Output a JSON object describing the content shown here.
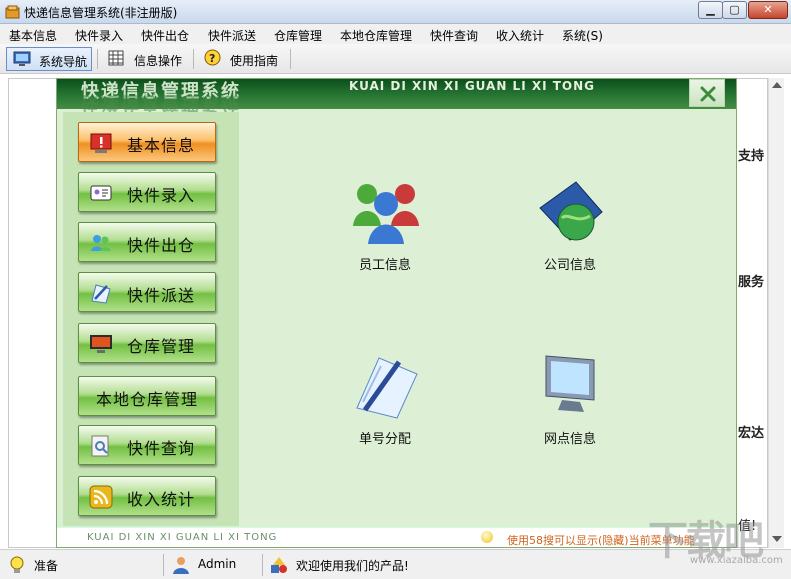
{
  "window": {
    "title": "快递信息管理系统(非注册版)",
    "min": "▁",
    "max": "▢",
    "close": "✕"
  },
  "menu": [
    "基本信息",
    "快件录入",
    "快件出仓",
    "快件派送",
    "仓库管理",
    "本地仓库管理",
    "快件查询",
    "收入统计",
    "系统(S)"
  ],
  "toolbar": {
    "items": [
      {
        "label": "系统导航",
        "icon": "monitor-icon",
        "active": true
      },
      {
        "label": "信息操作",
        "icon": "grid-icon",
        "active": false
      },
      {
        "label": "使用指南",
        "icon": "help-icon",
        "active": false
      }
    ]
  },
  "background_text": [
    "支持",
    "服务",
    "宏达",
    "值!"
  ],
  "panel": {
    "title_cn": "快递信息管理系统",
    "title_en": "KUAI DI XIN XI GUAN LI XI TONG",
    "sidebar": [
      {
        "label": "基本信息",
        "icon": "alert-icon",
        "active": true
      },
      {
        "label": "快件录入",
        "icon": "id-card-icon",
        "active": false
      },
      {
        "label": "快件出仓",
        "icon": "people-icon",
        "active": false
      },
      {
        "label": "快件派送",
        "icon": "pen-icon",
        "active": false
      },
      {
        "label": "仓库管理",
        "icon": "monitor-icon",
        "active": false
      },
      {
        "label": "本地仓库管理",
        "icon": "",
        "active": false
      },
      {
        "label": "快件查询",
        "icon": "search-doc-icon",
        "active": false
      },
      {
        "label": "收入统计",
        "icon": "rss-icon",
        "active": false
      }
    ],
    "tiles": [
      {
        "label": "员工信息",
        "icon": "users-icon"
      },
      {
        "label": "公司信息",
        "icon": "globe-icon"
      },
      {
        "label": "单号分配",
        "icon": "notepad-icon"
      },
      {
        "label": "网点信息",
        "icon": "computer-icon"
      }
    ],
    "bottom_left": "KUAI DI XIN XI GUAN LI XI TONG",
    "bottom_right": "使用58搜可以显示(隐藏)当前菜单功能"
  },
  "status": {
    "state": "准备",
    "user": "Admin",
    "message": "欢迎使用我们的产品!"
  },
  "watermark": {
    "text": "下载吧",
    "sub": "www.xiazaiba.com"
  },
  "colors": {
    "panel_header": "#1c6a2a",
    "active_btn": "#f08f22",
    "normal_btn": "#73c043",
    "bottom_text": "#d0641e"
  }
}
